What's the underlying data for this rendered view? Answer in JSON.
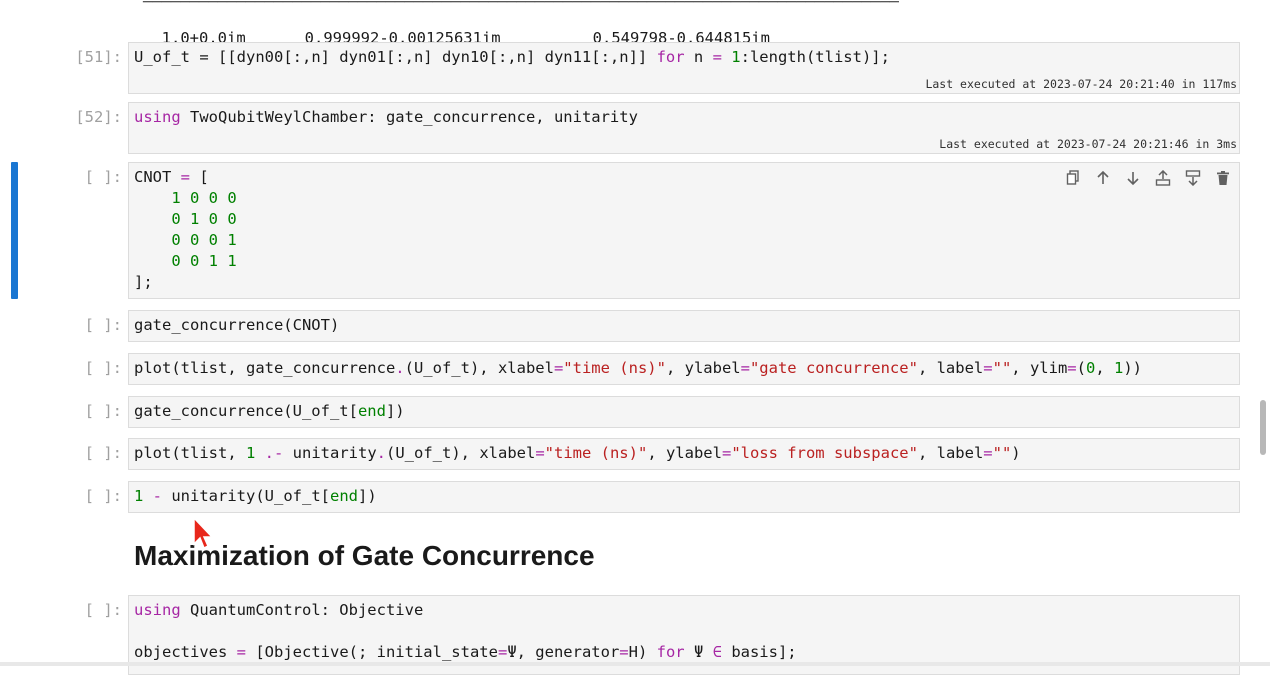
{
  "output_top": {
    "row1": {
      "c1": "1.0+0.0im",
      "c2": "0.999992-0.00125631im",
      "c3": "0.549798-0.644815im"
    }
  },
  "cells": {
    "c51": {
      "prompt": "[51]:",
      "exec": "Last executed at 2023-07-24 20:21:40 in 117ms",
      "code": {
        "a": "U_of_t",
        "b": " = [[dyn00[:,n] dyn01[:,n] dyn10[:,n] dyn11[:,n]] ",
        "kw_for": "for",
        "c": " n ",
        "op_eq": "=",
        "num1": "1",
        "d": ":length(tlist)];"
      }
    },
    "c52": {
      "prompt": "[52]:",
      "exec": "Last executed at 2023-07-24 20:21:46 in 3ms",
      "code": {
        "kw_using": "using",
        "rest": " TwoQubitWeylChamber: gate_concurrence, unitarity"
      }
    },
    "cnot": {
      "prompt": "[ ]:",
      "line0_a": "CNOT ",
      "line0_op": "=",
      "line0_b": " [",
      "rows": [
        "    1 0 0 0",
        "    0 1 0 0",
        "    0 0 0 1",
        "    0 0 1 1"
      ],
      "end": "];"
    },
    "gc": {
      "prompt": "[ ]:",
      "code": "gate_concurrence(CNOT)"
    },
    "plot1": {
      "prompt": "[ ]:",
      "p1": "plot(tlist, gate_concurrence",
      "dot": ".",
      "p2": "(U_of_t), xlabel",
      "eq": "=",
      "s1": "\"time (ns)\"",
      "p3": ", ylabel",
      "s2": "\"gate concurrence\"",
      "p4": ", label",
      "s3": "\"\"",
      "p5": ", ylim",
      "p6": "(",
      "n0": "0",
      "p7": ", ",
      "n1": "1",
      "p8": "))"
    },
    "gcend": {
      "prompt": "[ ]:",
      "a": "gate_concurrence(U_of_t[",
      "kw": "end",
      "b": "])"
    },
    "plot2": {
      "prompt": "[ ]:",
      "p1": "plot(tlist, ",
      "n1": "1",
      "op": " .-",
      "p2": " unitarity",
      "dot": ".",
      "p3": "(U_of_t), xlabel",
      "eq": "=",
      "s1": "\"time (ns)\"",
      "p4": ", ylabel",
      "s2": "\"loss from subspace\"",
      "p5": ", label",
      "s3": "\"\"",
      "p6": ")"
    },
    "unit": {
      "prompt": "[ ]:",
      "n1": "1",
      "op": " -",
      "a": " unitarity(U_of_t[",
      "kw": "end",
      "b": "])"
    },
    "obj": {
      "prompt": "[ ]:",
      "l1_kw": "using",
      "l1_rest": " QuantumControl: Objective",
      "l2_a": "objectives ",
      "l2_eq": "=",
      "l2_b": " [Objective(; initial_state",
      "l2_eq2": "=",
      "l2_c": "Ψ, generator",
      "l2_eq3": "=",
      "l2_d": "H) ",
      "l2_for": "for",
      "l2_e": " Ψ ",
      "l2_in": "∈",
      "l2_f": " basis];"
    }
  },
  "heading": "Maximization of Gate Concurrence",
  "icons": [
    "copy-icon",
    "arrow-up-icon",
    "arrow-down-icon",
    "insert-above-icon",
    "insert-below-icon",
    "trash-icon",
    "mouse-cursor-icon"
  ],
  "colors": {
    "active": "#1976d2",
    "keyword": "#a626a4",
    "number": "#008000",
    "string": "#ba2121"
  }
}
